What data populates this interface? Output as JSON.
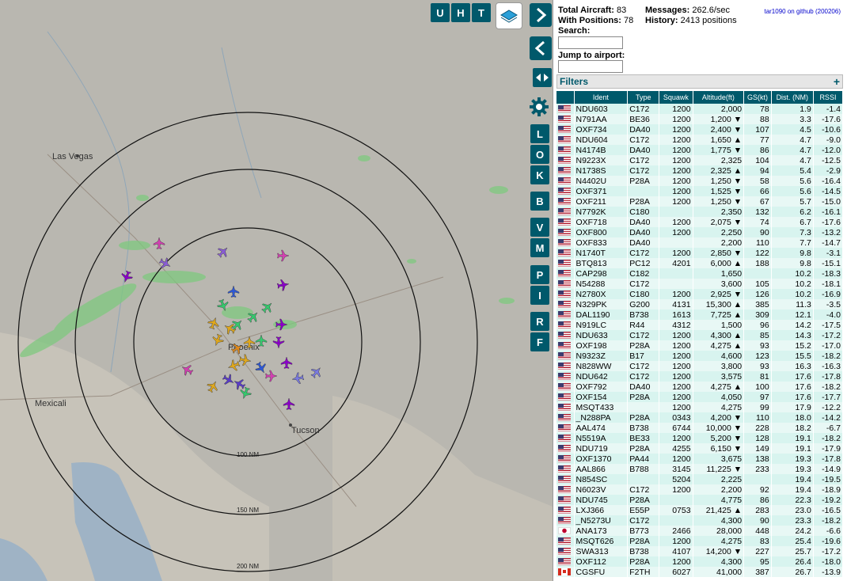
{
  "stats": {
    "total_aircraft_label": "Total Aircraft:",
    "total_aircraft": "83",
    "with_positions_label": "With Positions:",
    "with_positions": "78",
    "messages_label": "Messages:",
    "messages": "262.6/sec",
    "history_label": "History:",
    "history": "2413 positions",
    "github_link": "tar1090 on github (200206)"
  },
  "search": {
    "label": "Search:",
    "value": ""
  },
  "airport": {
    "label": "Jump to airport:",
    "value": ""
  },
  "filters": {
    "label": "Filters",
    "toggle": "+"
  },
  "map_buttons": {
    "top": [
      "U",
      "H",
      "T"
    ],
    "side": [
      "L",
      "O",
      "K",
      "B",
      "V",
      "M",
      "P",
      "I",
      "R",
      "F"
    ]
  },
  "map_labels": {
    "cities": [
      "Las Vegas",
      "Phoenix",
      "Mexicali",
      "Tucson"
    ],
    "rings": [
      "100 NM",
      "150 NM",
      "200 NM"
    ]
  },
  "table": {
    "headers": [
      "",
      "Ident",
      "Type",
      "Squawk",
      "Altitude(ft)",
      "GS(kt)",
      "Dist. (NM)",
      "RSSI"
    ],
    "rows": [
      {
        "flag": "us",
        "ident": "NDU603",
        "type": "C172",
        "squawk": "1200",
        "alt": "2,000",
        "gs": "78",
        "dist": "1.9",
        "rssi": "-1.4"
      },
      {
        "flag": "us",
        "ident": "N791AA",
        "type": "BE36",
        "squawk": "1200",
        "alt": "1,200 ▼",
        "gs": "88",
        "dist": "3.3",
        "rssi": "-17.6"
      },
      {
        "flag": "us",
        "ident": "OXF734",
        "type": "DA40",
        "squawk": "1200",
        "alt": "2,400 ▼",
        "gs": "107",
        "dist": "4.5",
        "rssi": "-10.6"
      },
      {
        "flag": "us",
        "ident": "NDU604",
        "type": "C172",
        "squawk": "1200",
        "alt": "1,650 ▲",
        "gs": "77",
        "dist": "4.7",
        "rssi": "-9.0"
      },
      {
        "flag": "us",
        "ident": "N4174B",
        "type": "DA40",
        "squawk": "1200",
        "alt": "1,775 ▼",
        "gs": "86",
        "dist": "4.7",
        "rssi": "-12.0"
      },
      {
        "flag": "us",
        "ident": "N9223X",
        "type": "C172",
        "squawk": "1200",
        "alt": "2,325",
        "gs": "104",
        "dist": "4.7",
        "rssi": "-12.5"
      },
      {
        "flag": "us",
        "ident": "N1738S",
        "type": "C172",
        "squawk": "1200",
        "alt": "2,325 ▲",
        "gs": "94",
        "dist": "5.4",
        "rssi": "-2.9"
      },
      {
        "flag": "us",
        "ident": "N4402U",
        "type": "P28A",
        "squawk": "1200",
        "alt": "1,250 ▼",
        "gs": "58",
        "dist": "5.6",
        "rssi": "-16.4"
      },
      {
        "flag": "us",
        "ident": "OXF371",
        "type": "",
        "squawk": "1200",
        "alt": "1,525 ▼",
        "gs": "66",
        "dist": "5.6",
        "rssi": "-14.5"
      },
      {
        "flag": "us",
        "ident": "OXF211",
        "type": "P28A",
        "squawk": "1200",
        "alt": "1,250 ▼",
        "gs": "67",
        "dist": "5.7",
        "rssi": "-15.0"
      },
      {
        "flag": "us",
        "ident": "N7792K",
        "type": "C180",
        "squawk": "",
        "alt": "2,350",
        "gs": "132",
        "dist": "6.2",
        "rssi": "-16.1"
      },
      {
        "flag": "us",
        "ident": "OXF718",
        "type": "DA40",
        "squawk": "1200",
        "alt": "2,075 ▼",
        "gs": "74",
        "dist": "6.7",
        "rssi": "-17.6"
      },
      {
        "flag": "us",
        "ident": "OXF800",
        "type": "DA40",
        "squawk": "1200",
        "alt": "2,250",
        "gs": "90",
        "dist": "7.3",
        "rssi": "-13.2"
      },
      {
        "flag": "us",
        "ident": "OXF833",
        "type": "DA40",
        "squawk": "",
        "alt": "2,200",
        "gs": "110",
        "dist": "7.7",
        "rssi": "-14.7"
      },
      {
        "flag": "us",
        "ident": "N1740T",
        "type": "C172",
        "squawk": "1200",
        "alt": "2,850 ▼",
        "gs": "122",
        "dist": "9.8",
        "rssi": "-3.1"
      },
      {
        "flag": "us",
        "ident": "BTQ813",
        "type": "PC12",
        "squawk": "4201",
        "alt": "6,000 ▲",
        "gs": "188",
        "dist": "9.8",
        "rssi": "-15.1"
      },
      {
        "flag": "us",
        "ident": "CAP298",
        "type": "C182",
        "squawk": "",
        "alt": "1,650",
        "gs": "",
        "dist": "10.2",
        "rssi": "-18.3"
      },
      {
        "flag": "us",
        "ident": "N54288",
        "type": "C172",
        "squawk": "",
        "alt": "3,600",
        "gs": "105",
        "dist": "10.2",
        "rssi": "-18.1"
      },
      {
        "flag": "us",
        "ident": "N2780X",
        "type": "C180",
        "squawk": "1200",
        "alt": "2,925 ▼",
        "gs": "126",
        "dist": "10.2",
        "rssi": "-16.9"
      },
      {
        "flag": "us",
        "ident": "N329PK",
        "type": "G200",
        "squawk": "4131",
        "alt": "15,300 ▲",
        "gs": "385",
        "dist": "11.3",
        "rssi": "-3.5"
      },
      {
        "flag": "us",
        "ident": "DAL1190",
        "type": "B738",
        "squawk": "1613",
        "alt": "7,725 ▲",
        "gs": "309",
        "dist": "12.1",
        "rssi": "-4.0"
      },
      {
        "flag": "us",
        "ident": "N919LC",
        "type": "R44",
        "squawk": "4312",
        "alt": "1,500",
        "gs": "96",
        "dist": "14.2",
        "rssi": "-17.5"
      },
      {
        "flag": "us",
        "ident": "NDU633",
        "type": "C172",
        "squawk": "1200",
        "alt": "4,300 ▲",
        "gs": "85",
        "dist": "14.3",
        "rssi": "-17.2"
      },
      {
        "flag": "us",
        "ident": "OXF198",
        "type": "P28A",
        "squawk": "1200",
        "alt": "4,275 ▲",
        "gs": "93",
        "dist": "15.2",
        "rssi": "-17.0"
      },
      {
        "flag": "us",
        "ident": "N9323Z",
        "type": "B17",
        "squawk": "1200",
        "alt": "4,600",
        "gs": "123",
        "dist": "15.5",
        "rssi": "-18.2"
      },
      {
        "flag": "us",
        "ident": "N828WW",
        "type": "C172",
        "squawk": "1200",
        "alt": "3,800",
        "gs": "93",
        "dist": "16.3",
        "rssi": "-16.3"
      },
      {
        "flag": "us",
        "ident": "NDU642",
        "type": "C172",
        "squawk": "1200",
        "alt": "3,575",
        "gs": "81",
        "dist": "17.6",
        "rssi": "-17.8"
      },
      {
        "flag": "us",
        "ident": "OXF792",
        "type": "DA40",
        "squawk": "1200",
        "alt": "4,275 ▲",
        "gs": "100",
        "dist": "17.6",
        "rssi": "-18.2"
      },
      {
        "flag": "us",
        "ident": "OXF154",
        "type": "P28A",
        "squawk": "1200",
        "alt": "4,050",
        "gs": "97",
        "dist": "17.6",
        "rssi": "-17.7"
      },
      {
        "flag": "us",
        "ident": "MSQT433",
        "type": "",
        "squawk": "1200",
        "alt": "4,275",
        "gs": "99",
        "dist": "17.9",
        "rssi": "-12.2"
      },
      {
        "flag": "us",
        "ident": "_N288PA",
        "type": "P28A",
        "squawk": "0343",
        "alt": "4,200 ▼",
        "gs": "110",
        "dist": "18.0",
        "rssi": "-14.2"
      },
      {
        "flag": "us",
        "ident": "AAL474",
        "type": "B738",
        "squawk": "6744",
        "alt": "10,000 ▼",
        "gs": "228",
        "dist": "18.2",
        "rssi": "-6.7"
      },
      {
        "flag": "us",
        "ident": "N5519A",
        "type": "BE33",
        "squawk": "1200",
        "alt": "5,200 ▼",
        "gs": "128",
        "dist": "19.1",
        "rssi": "-18.2"
      },
      {
        "flag": "us",
        "ident": "NDU719",
        "type": "P28A",
        "squawk": "4255",
        "alt": "6,150 ▼",
        "gs": "149",
        "dist": "19.1",
        "rssi": "-17.9"
      },
      {
        "flag": "us",
        "ident": "OXF1370",
        "type": "PA44",
        "squawk": "1200",
        "alt": "3,675",
        "gs": "138",
        "dist": "19.3",
        "rssi": "-17.8"
      },
      {
        "flag": "us",
        "ident": "AAL866",
        "type": "B788",
        "squawk": "3145",
        "alt": "11,225 ▼",
        "gs": "233",
        "dist": "19.3",
        "rssi": "-14.9"
      },
      {
        "flag": "us",
        "ident": "N854SC",
        "type": "",
        "squawk": "5204",
        "alt": "2,225",
        "gs": "",
        "dist": "19.4",
        "rssi": "-19.5"
      },
      {
        "flag": "us",
        "ident": "N6023V",
        "type": "C172",
        "squawk": "1200",
        "alt": "2,200",
        "gs": "92",
        "dist": "19.4",
        "rssi": "-18.9"
      },
      {
        "flag": "us",
        "ident": "NDU745",
        "type": "P28A",
        "squawk": "",
        "alt": "4,775",
        "gs": "86",
        "dist": "22.3",
        "rssi": "-19.2"
      },
      {
        "flag": "us",
        "ident": "LXJ366",
        "type": "E55P",
        "squawk": "0753",
        "alt": "21,425 ▲",
        "gs": "283",
        "dist": "23.0",
        "rssi": "-16.5"
      },
      {
        "flag": "us",
        "ident": "_N5273U",
        "type": "C172",
        "squawk": "",
        "alt": "4,300",
        "gs": "90",
        "dist": "23.3",
        "rssi": "-18.2"
      },
      {
        "flag": "jp",
        "ident": "ANA173",
        "type": "B773",
        "squawk": "2466",
        "alt": "28,000",
        "gs": "448",
        "dist": "24.2",
        "rssi": "-6.6"
      },
      {
        "flag": "us",
        "ident": "MSQT626",
        "type": "P28A",
        "squawk": "1200",
        "alt": "4,275",
        "gs": "83",
        "dist": "25.4",
        "rssi": "-19.6"
      },
      {
        "flag": "us",
        "ident": "SWA313",
        "type": "B738",
        "squawk": "4107",
        "alt": "14,200 ▼",
        "gs": "227",
        "dist": "25.7",
        "rssi": "-17.2"
      },
      {
        "flag": "us",
        "ident": "OXF112",
        "type": "P28A",
        "squawk": "1200",
        "alt": "4,300",
        "gs": "95",
        "dist": "26.4",
        "rssi": "-18.0"
      },
      {
        "flag": "ca",
        "ident": "CGSFU",
        "type": "F2TH",
        "squawk": "6027",
        "alt": "41,000",
        "gs": "387",
        "dist": "26.7",
        "rssi": "-13.9"
      }
    ]
  }
}
